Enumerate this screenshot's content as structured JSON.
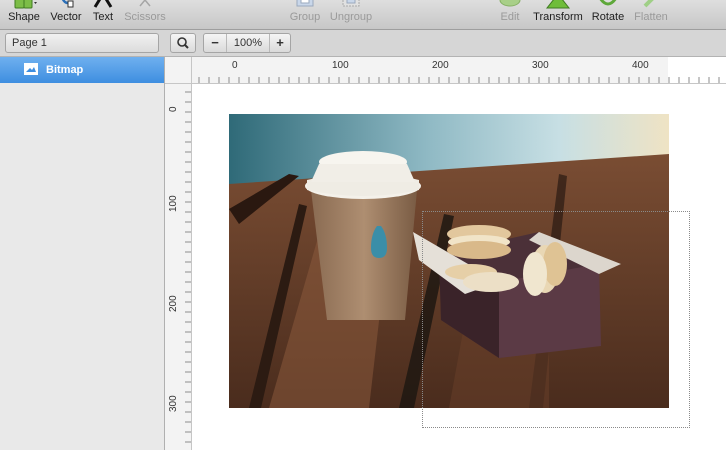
{
  "toolbar": {
    "shape_label": "Shape",
    "vector_label": "Vector",
    "text_label": "Text",
    "scissors_label": "Scissors",
    "group_label": "Group",
    "ungroup_label": "Ungroup",
    "edit_label": "Edit",
    "transform_label": "Transform",
    "rotate_label": "Rotate",
    "flatten_label": "Flatten"
  },
  "page_selector": {
    "value": "Page 1"
  },
  "zoom": {
    "minus": "−",
    "value": "100%",
    "plus": "+"
  },
  "layers": [
    {
      "label": "Bitmap",
      "selected": true,
      "icon": "bitmap-icon"
    }
  ],
  "ruler": {
    "horizontal": [
      "0",
      "100",
      "200",
      "300",
      "400"
    ],
    "vertical": [
      "0",
      "100",
      "200",
      "300"
    ]
  },
  "colors": {
    "selection_blue": "#3e8ee0",
    "toolbar_gray": "#d0d0d0",
    "sidebar_gray": "#e9e9e9"
  }
}
